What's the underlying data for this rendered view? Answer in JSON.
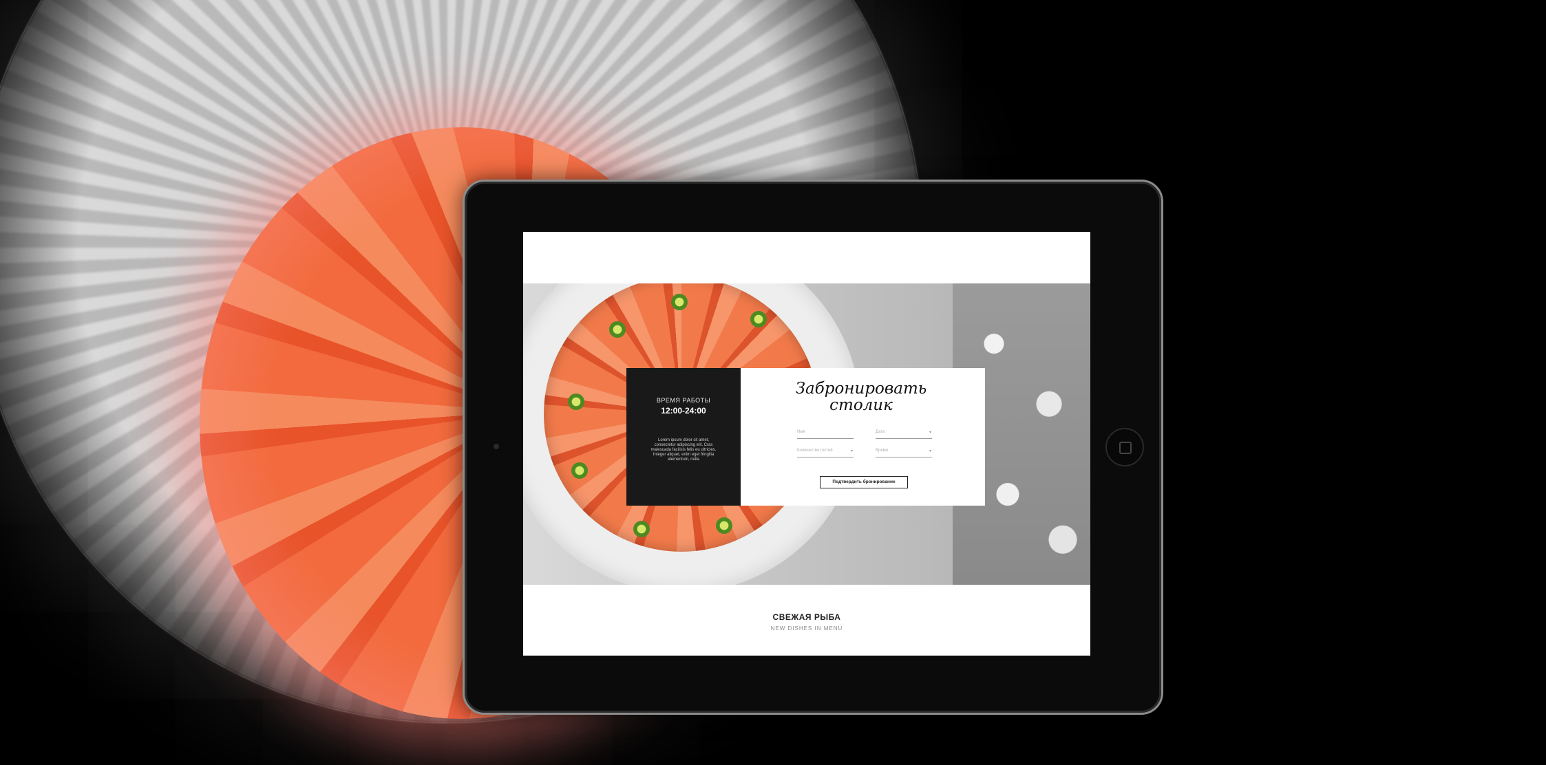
{
  "hours": {
    "title": "ВРЕМЯ РАБОТЫ",
    "value": "12:00-24:00"
  },
  "panel": {
    "description": "Lorem ipsum dolor sit amet, consectetur adipiscing elit. Cras malesuada facilisis felis eu ultricies. Integer aliquet, enim eget fringilla elementum, nulla"
  },
  "booking": {
    "title_line1": "Забронировать",
    "title_line2": "столик",
    "fields": [
      "Имя",
      "Дата",
      "Количество гостей",
      "Время"
    ],
    "confirm_label": "Подтвердить бронирование"
  },
  "section": {
    "title": "СВЕЖАЯ РЫБА",
    "subtitle": "NEW DISHES IN MENU"
  },
  "colors": {
    "dark_panel": "#191919",
    "salmon": "#f27a4a",
    "background": "#000000"
  },
  "icons": {
    "home_button": "home-button-icon",
    "camera": "camera-icon",
    "field_chevron": "chevron-down-icon"
  }
}
